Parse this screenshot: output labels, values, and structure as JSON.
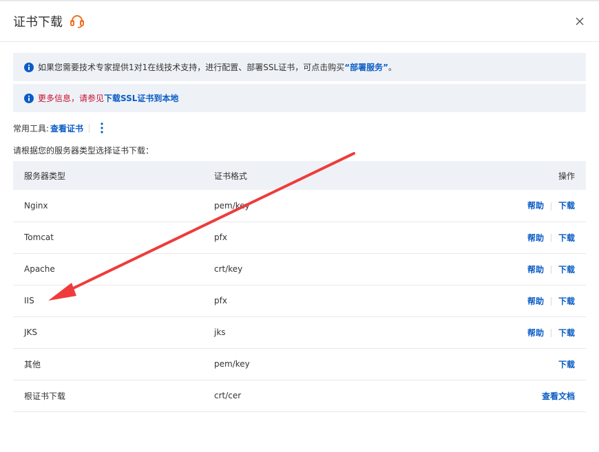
{
  "dialog": {
    "title": "证书下载",
    "support_icon": "headset-icon",
    "close_icon": "close-icon"
  },
  "notices": {
    "notice1": {
      "text_before": "如果您需要技术专家提供1对1在线技术支持，进行配置、部署SSL证书，可点击购买",
      "link": "“部署服务”",
      "text_after": "。"
    },
    "notice2": {
      "text_before": "更多信息，请参见",
      "link": "下载SSL证书到本地"
    }
  },
  "tools": {
    "label": "常用工具:",
    "view_cert": "查看证书",
    "more_icon": "more-vertical-icon"
  },
  "choose_label": "请根据您的服务器类型选择证书下载：",
  "table": {
    "headers": [
      "服务器类型",
      "证书格式",
      "操作"
    ],
    "rows": [
      {
        "server": "Nginx",
        "format": "pem/key",
        "help": "帮助",
        "action": "下载"
      },
      {
        "server": "Tomcat",
        "format": "pfx",
        "help": "帮助",
        "action": "下载"
      },
      {
        "server": "Apache",
        "format": "crt/key",
        "help": "帮助",
        "action": "下载"
      },
      {
        "server": "IIS",
        "format": "pfx",
        "help": "帮助",
        "action": "下载"
      },
      {
        "server": "JKS",
        "format": "jks",
        "help": "帮助",
        "action": "下载"
      },
      {
        "server": "其他",
        "format": "pem/key",
        "action": "下载"
      },
      {
        "server": "根证书下载",
        "format": "crt/cer",
        "action": "查看文档"
      }
    ]
  },
  "colors": {
    "link": "#0b5cc5",
    "notice_bg": "#eef2f7",
    "info_icon": "#0b5cc5",
    "warning_text": "#c8102e",
    "annotation_arrow": "#ef3b3b",
    "support_icon": "#f26f21"
  }
}
